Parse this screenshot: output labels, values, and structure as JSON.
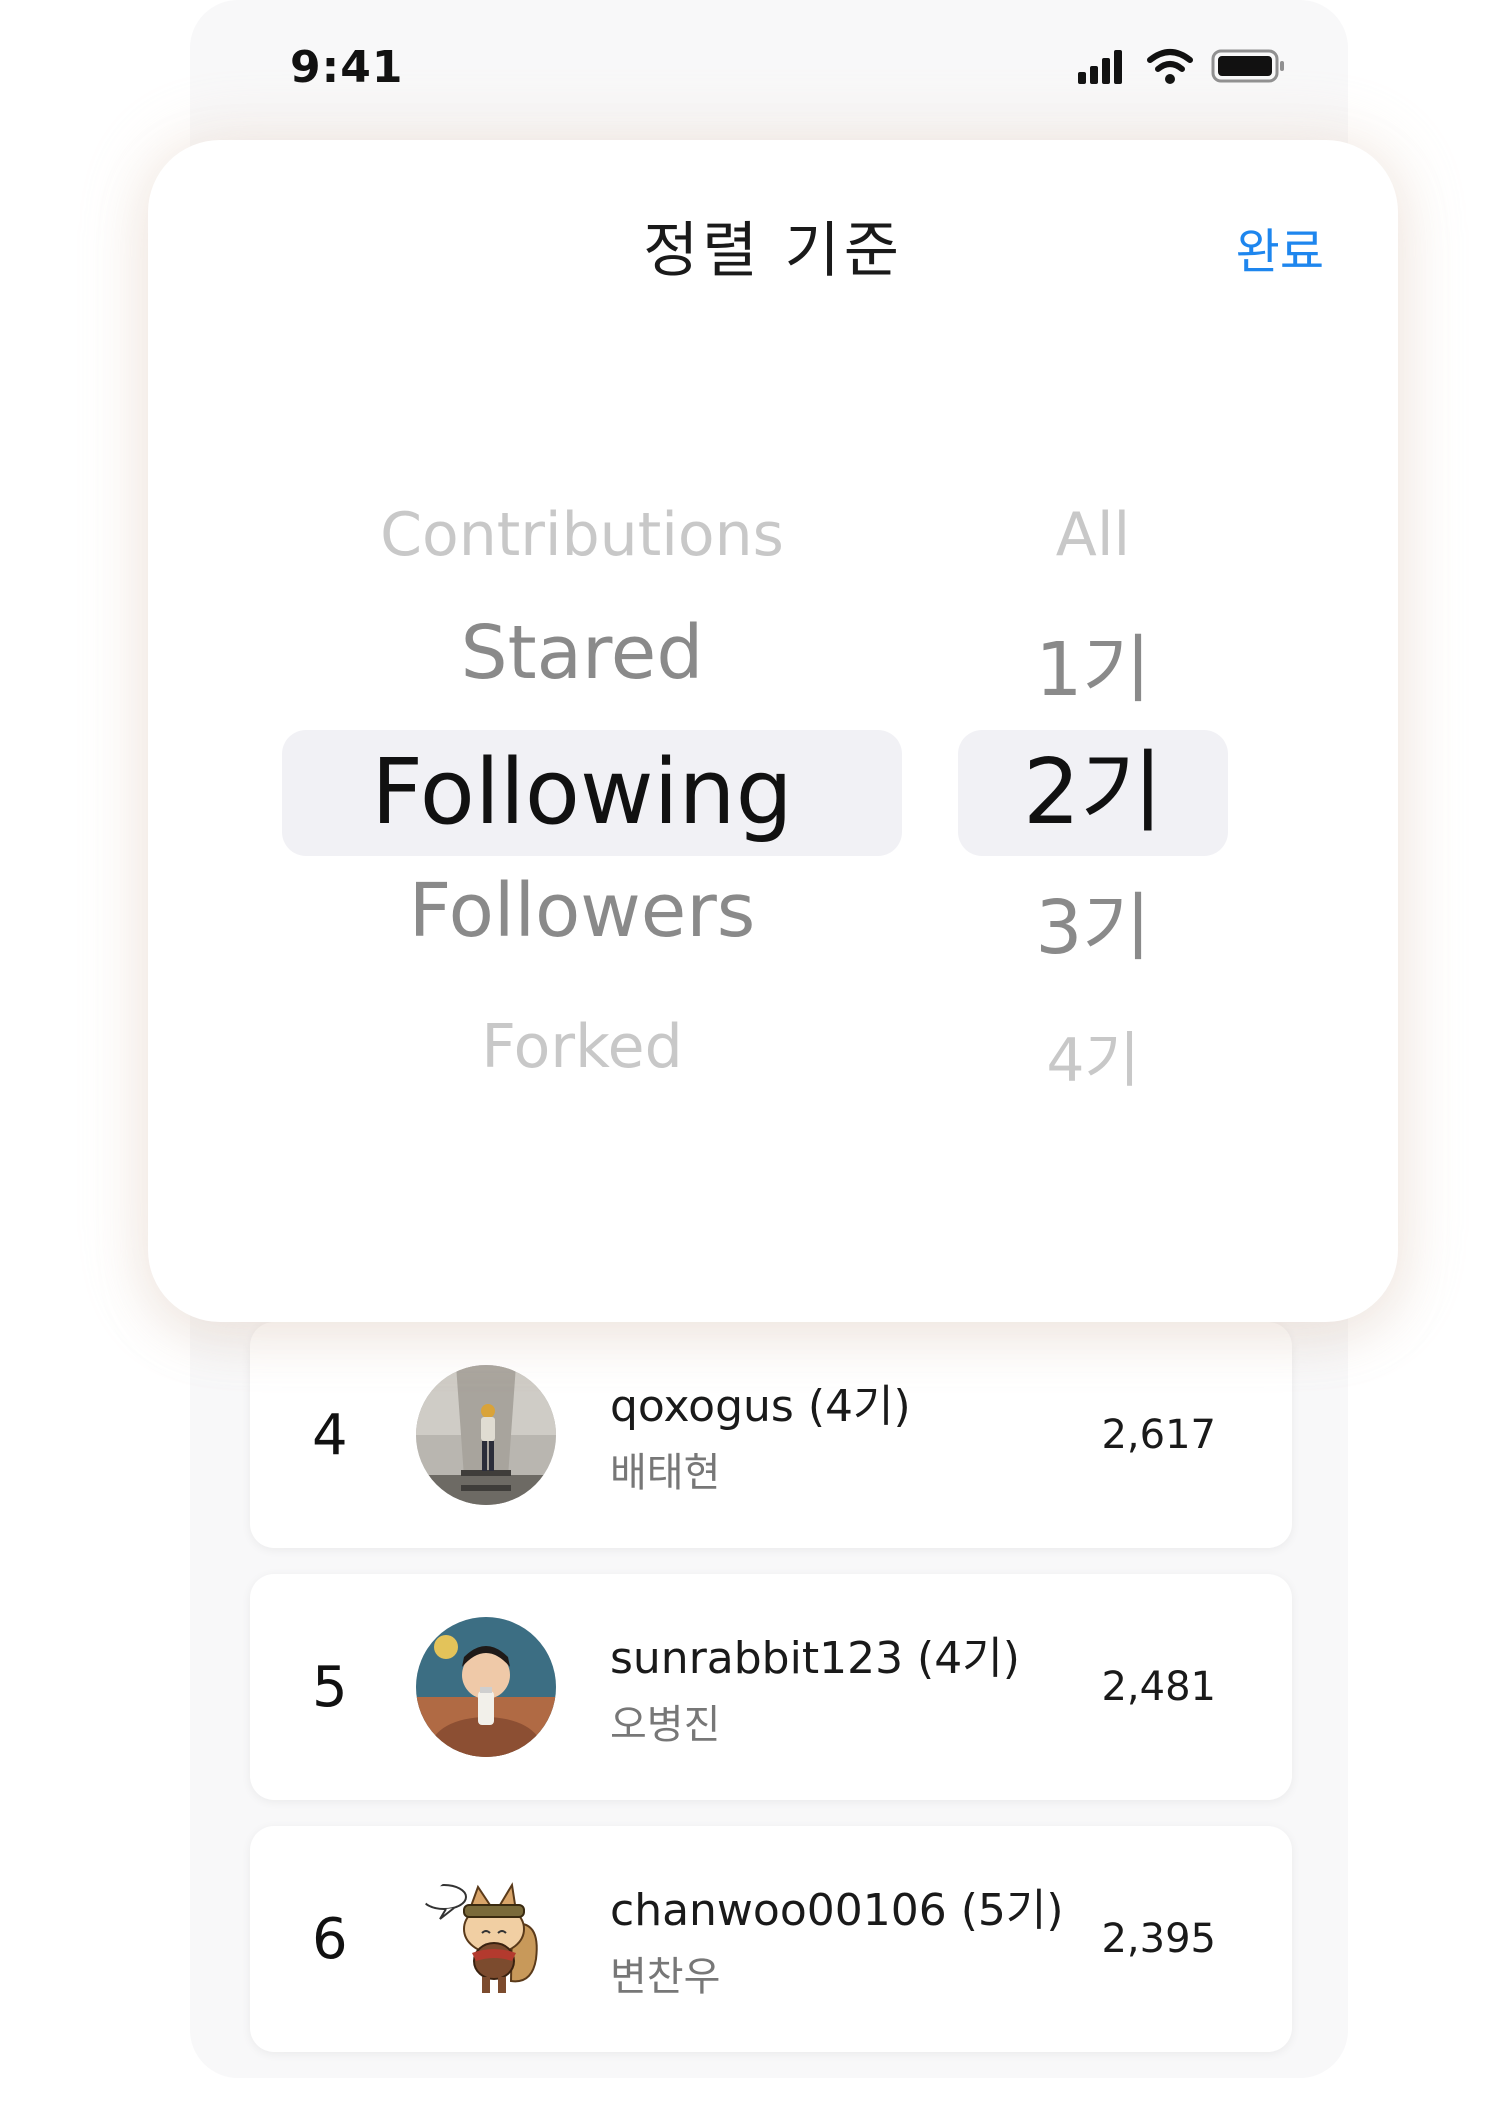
{
  "status_bar": {
    "time": "9:41"
  },
  "sheet": {
    "title": "정렬 기준",
    "done_label": "완료"
  },
  "picker": {
    "sort_options": [
      "Contributions",
      "Stared",
      "Following",
      "Followers",
      "Forked"
    ],
    "generation_options": [
      "All",
      "1기",
      "2기",
      "3기",
      "4기"
    ],
    "selected_sort": "Following",
    "selected_generation": "2기"
  },
  "leaderboard": [
    {
      "rank": "4",
      "username": "qoxogus (4기)",
      "name": "배태현",
      "count": "2,617",
      "avatar": "photo-person-hallway"
    },
    {
      "rank": "5",
      "username": "sunrabbit123 (4기)",
      "name": "오병진",
      "count": "2,481",
      "avatar": "photo-person-drinking"
    },
    {
      "rank": "6",
      "username": "chanwoo00106 (5기)",
      "name": "변찬우",
      "count": "2,395",
      "avatar": "cartoon-character"
    }
  ],
  "colors": {
    "accent": "#1e86ee",
    "selection_bg": "#f1f1f5",
    "phone_bg": "#f8f8f9"
  }
}
